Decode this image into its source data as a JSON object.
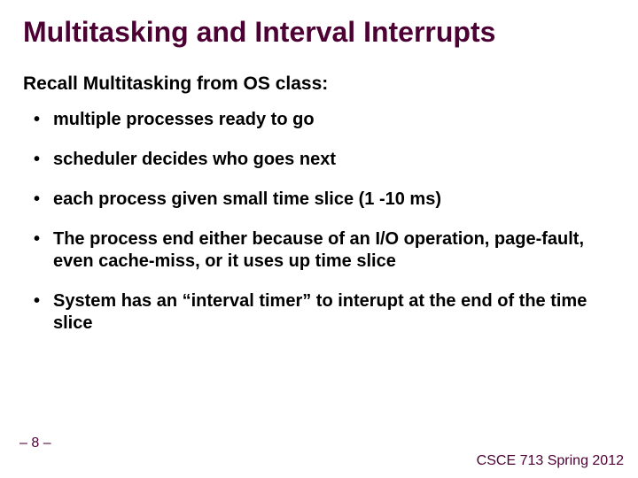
{
  "title": "Multitasking and Interval Interrupts",
  "subhead": "Recall Multitasking from OS class:",
  "bullets": [
    "multiple processes ready to go",
    "scheduler decides who goes next",
    "each process given small time slice (1 -10 ms)",
    "The process end either because of an I/O operation, page-fault, even cache-miss, or it uses up time slice",
    "System has an “interval timer” to interupt at the end of the time slice"
  ],
  "footer": {
    "page": "– 8 –",
    "course": "CSCE 713 Spring 2012"
  }
}
